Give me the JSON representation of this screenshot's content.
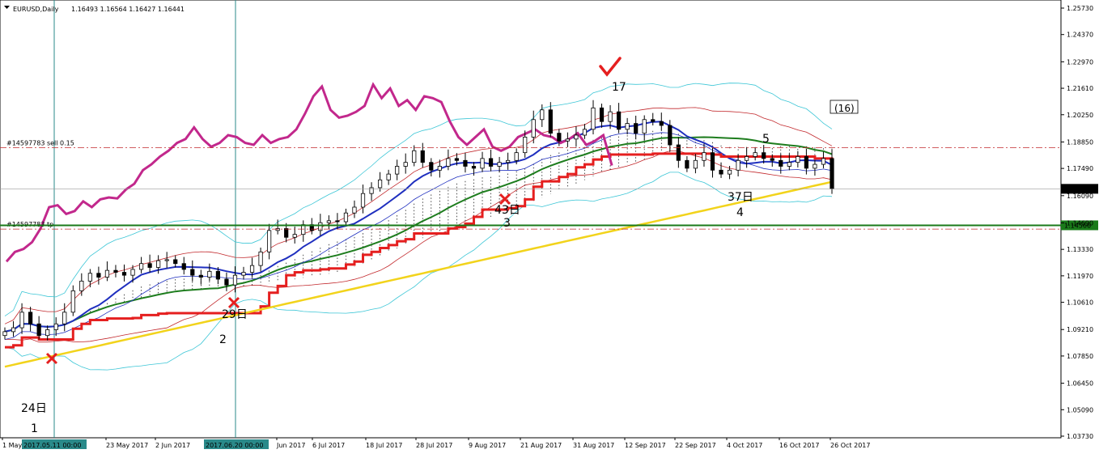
{
  "title": {
    "symbol_label": "EURUSD,Daily",
    "ohlc": "1.16493 1.16564 1.16427 1.16441"
  },
  "colors": {
    "background": "#ffffff",
    "axis": "#000000",
    "candle_up": "#ffffff",
    "candle_down": "#000000",
    "kijun": "#e51f1f",
    "blue_ma": "#1f2fbf",
    "green_ma": "#1e7d1e",
    "yellow_ma": "#f2d31b",
    "chikou": "#c2288c",
    "bb_outer": "#3cc6d6",
    "bb_inner": "#c2282c",
    "cross": "#e51f1f",
    "check": "#e51f1f",
    "sell_line": "#c2282c",
    "tp_line": "#1a7a1a",
    "price_box": "#000000",
    "tp_box": "#1a7a1a"
  },
  "chart_data": {
    "type": "candlestick",
    "y_axis": {
      "range": [
        1.0373,
        1.2573
      ],
      "ticks": [
        "1.25730",
        "1.24370",
        "1.22970",
        "1.21610",
        "1.20250",
        "1.18850",
        "1.17490",
        "1.16090",
        "1.14690",
        "1.13330",
        "1.11970",
        "1.10610",
        "1.09210",
        "1.07850",
        "1.06450",
        "1.05090",
        "1.03730"
      ]
    },
    "x_axis": {
      "ticks": [
        "1 May 2017",
        "23 May 2017",
        "2 Jun 2017",
        "Jun 2017",
        "6 Jul 2017",
        "18 Jul 2017",
        "28 Jul 2017",
        "9 Aug 2017",
        "21 Aug 2017",
        "31 Aug 2017",
        "12 Sep 2017",
        "22 Sep 2017",
        "4 Oct 2017",
        "16 Oct 2017",
        "26 Oct 2017"
      ],
      "highlighted_dates": [
        "2017.05.11 00:00",
        "2017.06.20 00:00"
      ]
    },
    "current_price": "1.16441",
    "take_profit_price": "1.14566",
    "orders": [
      {
        "label": "#14597783 sell 0.15",
        "price": 1.1855
      },
      {
        "label": "#14597783 tp",
        "price": 1.1437
      }
    ],
    "candle_close_path": [
      1.091,
      1.093,
      1.101,
      1.095,
      1.089,
      1.092,
      1.095,
      1.101,
      1.112,
      1.117,
      1.121,
      1.119,
      1.1225,
      1.1215,
      1.12,
      1.123,
      1.126,
      1.124,
      1.1275,
      1.128,
      1.126,
      1.123,
      1.12,
      1.119,
      1.122,
      1.118,
      1.115,
      1.12,
      1.1215,
      1.125,
      1.132,
      1.143,
      1.144,
      1.1395,
      1.141,
      1.146,
      1.143,
      1.147,
      1.148,
      1.1475,
      1.152,
      1.155,
      1.162,
      1.165,
      1.169,
      1.172,
      1.176,
      1.178,
      1.184,
      1.178,
      1.174,
      1.176,
      1.18,
      1.179,
      1.176,
      1.175,
      1.18,
      1.176,
      1.178,
      1.179,
      1.183,
      1.191,
      1.2,
      1.205,
      1.193,
      1.189,
      1.19,
      1.192,
      1.195,
      1.206,
      1.199,
      1.204,
      1.195,
      1.198,
      1.193,
      1.2,
      1.199,
      1.197,
      1.187,
      1.179,
      1.175,
      1.179,
      1.183,
      1.174,
      1.172,
      1.174,
      1.179,
      1.181,
      1.183,
      1.18,
      1.179,
      1.176,
      1.178,
      1.181,
      1.175,
      1.177,
      1.18,
      1.1644
    ],
    "annotations": {
      "wave_labels": [
        "1",
        "2",
        "3",
        "4",
        "5",
        "17",
        "(16)"
      ],
      "day_counts": [
        "24日",
        "29日",
        "43日",
        "37日"
      ]
    }
  }
}
